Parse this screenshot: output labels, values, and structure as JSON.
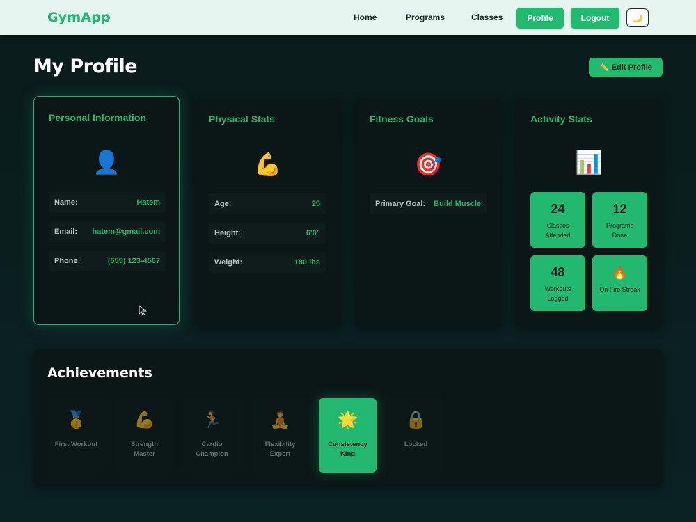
{
  "app": {
    "name": "GymApp"
  },
  "nav": {
    "home": "Home",
    "programs": "Programs",
    "classes": "Classes",
    "profile": "Profile",
    "logout": "Logout",
    "theme_icon": "🌙"
  },
  "header": {
    "title": "My Profile",
    "edit_icon": "✏️",
    "edit_label": "Edit Profile"
  },
  "personal": {
    "title": "Personal Information",
    "icon": "👤",
    "rows": [
      {
        "label": "Name:",
        "value": "Hatem"
      },
      {
        "label": "Email:",
        "value": "hatem@gmail.com"
      },
      {
        "label": "Phone:",
        "value": "(555) 123-4567"
      }
    ]
  },
  "physical": {
    "title": "Physical Stats",
    "icon": "💪",
    "rows": [
      {
        "label": "Age:",
        "value": "25"
      },
      {
        "label": "Height:",
        "value": "6'0\""
      },
      {
        "label": "Weight:",
        "value": "180 lbs"
      }
    ]
  },
  "goals": {
    "title": "Fitness Goals",
    "icon": "🎯",
    "rows": [
      {
        "label": "Primary Goal:",
        "value": "Build Muscle"
      }
    ]
  },
  "activity": {
    "title": "Activity Stats",
    "icon": "📊",
    "stats": [
      {
        "value": "24",
        "label": "Classes Attended"
      },
      {
        "value": "12",
        "label": "Programs Done"
      },
      {
        "value": "48",
        "label": "Workouts Logged"
      },
      {
        "value": "🔥",
        "label": "On Fire Streak"
      }
    ]
  },
  "achievements": {
    "title": "Achievements",
    "items": [
      {
        "icon": "🥇",
        "label": "First Workout",
        "earned": false
      },
      {
        "icon": "💪",
        "label": "Strength Master",
        "earned": false
      },
      {
        "icon": "🏃",
        "label": "Cardio Champion",
        "earned": false
      },
      {
        "icon": "🧘",
        "label": "Flexibility Expert",
        "earned": false
      },
      {
        "icon": "🌟",
        "label": "Consistency King",
        "earned": true
      },
      {
        "icon": "🔒",
        "label": "Locked",
        "earned": false
      }
    ]
  },
  "colors": {
    "accent": "#22b86f",
    "background": "#0a1b1b",
    "navbar": "#e7f5f0"
  }
}
